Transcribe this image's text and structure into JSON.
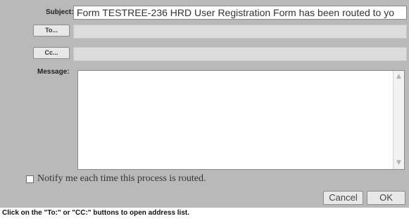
{
  "form": {
    "subject_label": "Subject:",
    "subject_value": "Form TESTREE-236 HRD User Registration Form has been routed to yo",
    "to_button": "To...",
    "cc_button": "Cc...",
    "message_label": "Message:",
    "notify_label": "Notify me each time this process is routed.",
    "notify_checked": false,
    "cancel_button": "Cancel",
    "ok_button": "OK"
  },
  "hint": "Click on the \"To:\" or \"CC:\" buttons to open address list."
}
